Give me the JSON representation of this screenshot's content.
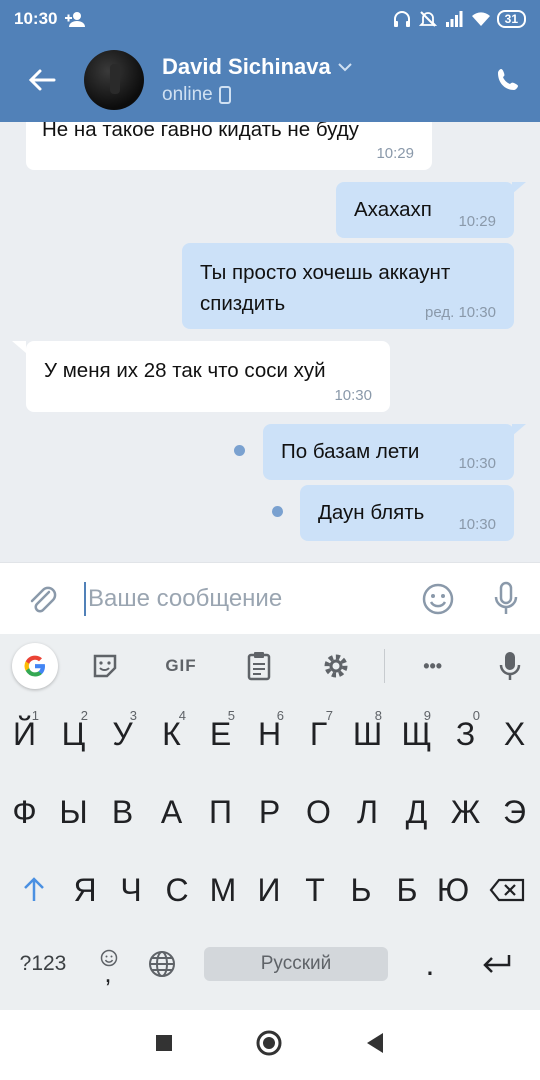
{
  "status_bar": {
    "time": "10:30",
    "battery": "31",
    "icons": [
      "person-add-icon",
      "headphones-icon",
      "bell-off-icon",
      "signal-icon",
      "wifi-icon",
      "battery-icon"
    ]
  },
  "header": {
    "name": "David Sichinava",
    "status": "online",
    "accent": "#5181b8"
  },
  "messages": [
    {
      "direction": "in",
      "text": "Не на такое гавно кидать не буду",
      "time": "10:29"
    },
    {
      "direction": "out",
      "text": "Ахахахп",
      "time": "10:29"
    },
    {
      "direction": "out",
      "text_line1": "Ты просто хочешь аккаунт",
      "text_line2": "спиздить",
      "time": "ред. 10:30"
    },
    {
      "direction": "in",
      "text": "У меня их 28 так что соси хуй",
      "time": "10:30"
    },
    {
      "direction": "out",
      "text": "По базам лети",
      "time": "10:30",
      "unread": true
    },
    {
      "direction": "out",
      "text": "Даун блять",
      "time": "10:30",
      "unread": true
    }
  ],
  "composer": {
    "placeholder": "Ваше сообщение"
  },
  "keyboard": {
    "toolbar": {
      "gif_label": "GIF",
      "more_label": "•••"
    },
    "row1": [
      "Й",
      "Ц",
      "У",
      "К",
      "Е",
      "Н",
      "Г",
      "Ш",
      "Щ",
      "З",
      "Х"
    ],
    "row1_hints": [
      "1",
      "2",
      "3",
      "4",
      "5",
      "6",
      "7",
      "8",
      "9",
      "0",
      ""
    ],
    "row2": [
      "Ф",
      "Ы",
      "В",
      "А",
      "П",
      "Р",
      "О",
      "Л",
      "Д",
      "Ж",
      "Э"
    ],
    "row3": [
      "Я",
      "Ч",
      "С",
      "М",
      "И",
      "Т",
      "Ь",
      "Б",
      "Ю"
    ],
    "symbols_label": "?123",
    "comma_label": ",",
    "space_label": "Русский",
    "period_label": "."
  }
}
